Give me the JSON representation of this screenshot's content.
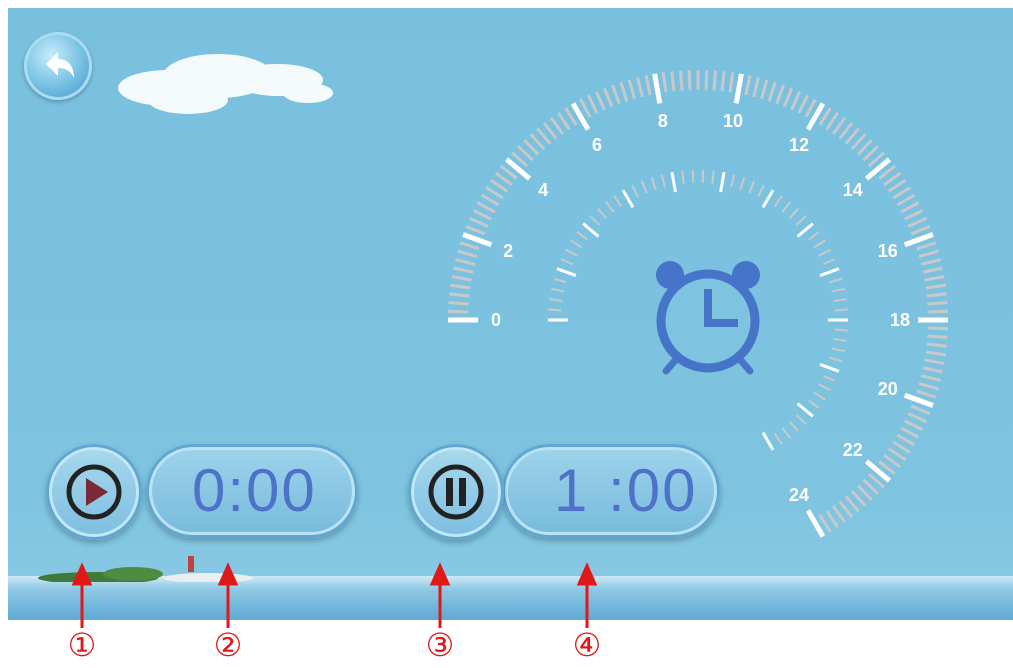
{
  "colors": {
    "background": "#7ec4e0",
    "time_text": "#4d72c8",
    "alarm_icon": "#4674c9",
    "callout": "#e01818",
    "play_triangle": "#7a2a36"
  },
  "back_button": {
    "icon": "back-arrow-icon"
  },
  "dial": {
    "outer_labels": [
      "0",
      "2",
      "4",
      "6",
      "8",
      "10",
      "12",
      "14",
      "16",
      "18",
      "20",
      "22",
      "24"
    ],
    "center_icon": "alarm-clock-icon"
  },
  "controls": {
    "play_button": {
      "icon": "play-icon"
    },
    "elapsed_time": "0:00",
    "pause_button": {
      "icon": "pause-icon"
    },
    "set_time": "1 :00"
  },
  "callouts": [
    "①",
    "②",
    "③",
    "④"
  ]
}
